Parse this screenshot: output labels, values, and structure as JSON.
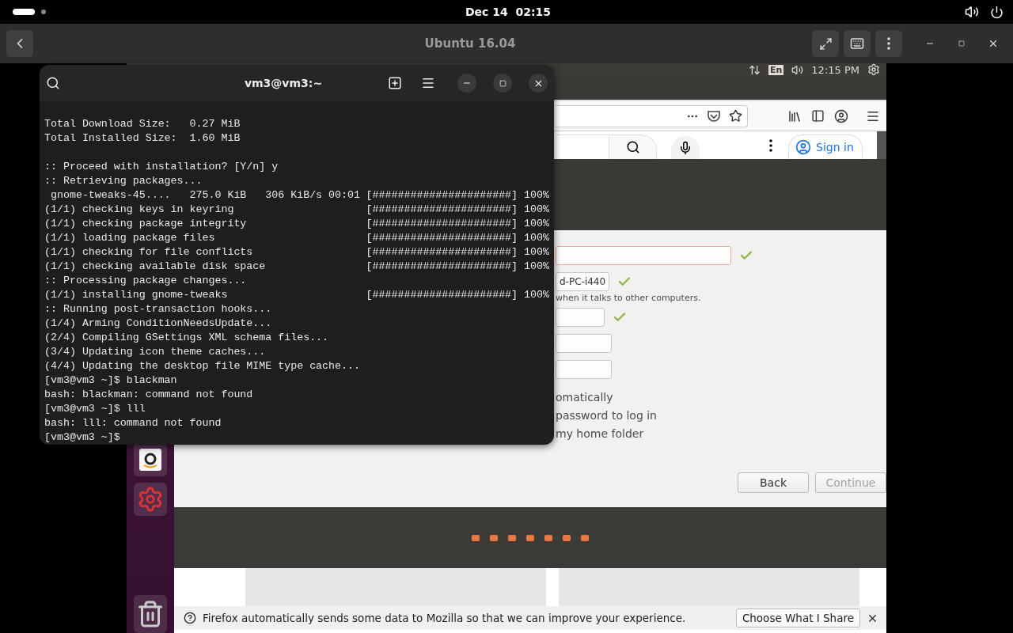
{
  "top_bar": {
    "date": "Dec 14",
    "time": "02:15"
  },
  "header": {
    "title": "Ubuntu 16.04"
  },
  "vm": {
    "panel": {
      "keyboard": "En",
      "time": "12:15 PM"
    },
    "browser": {
      "sign_in": "Sign in"
    },
    "installer": {
      "fields": [
        {
          "focused": true,
          "valid": true
        },
        {
          "value": "d-PC-i440",
          "focused": false,
          "valid": true
        },
        {
          "focused": false,
          "valid": true
        },
        {
          "focused": false,
          "valid": false
        },
        {
          "focused": false,
          "valid": false
        }
      ],
      "hint": "when it talks to other computers.",
      "options": [
        "omatically",
        "password to log in",
        "my home folder"
      ],
      "buttons": [
        {
          "label": "Back",
          "disabled": false
        },
        {
          "label": "Continue",
          "disabled": true
        }
      ]
    },
    "notification": {
      "text": "Firefox automatically sends some data to Mozilla so that we can improve your experience.",
      "button": "Choose What I Share"
    }
  },
  "terminal": {
    "title": "vm3@vm3:~",
    "lines": [
      {
        "kind": "text",
        "text": "Total Download Size:   0.27 MiB"
      },
      {
        "kind": "text",
        "text": "Total Installed Size:  1.60 MiB"
      },
      {
        "kind": "blank"
      },
      {
        "kind": "text",
        "text": ":: Proceed with installation? [Y/n] y"
      },
      {
        "kind": "text",
        "text": ":: Retrieving packages..."
      },
      {
        "kind": "progress",
        "text": " gnome-tweaks-45....   275.0 KiB   306 KiB/s 00:01",
        "bar": "[######################]",
        "percent": "100%"
      },
      {
        "kind": "progress",
        "text": "(1/1) checking keys in keyring",
        "bar": "[######################]",
        "percent": "100%"
      },
      {
        "kind": "progress",
        "text": "(1/1) checking package integrity",
        "bar": "[######################]",
        "percent": "100%"
      },
      {
        "kind": "progress",
        "text": "(1/1) loading package files",
        "bar": "[######################]",
        "percent": "100%"
      },
      {
        "kind": "progress",
        "text": "(1/1) checking for file conflicts",
        "bar": "[######################]",
        "percent": "100%"
      },
      {
        "kind": "progress",
        "text": "(1/1) checking available disk space",
        "bar": "[######################]",
        "percent": "100%"
      },
      {
        "kind": "text",
        "text": ":: Processing package changes..."
      },
      {
        "kind": "progress",
        "text": "(1/1) installing gnome-tweaks",
        "bar": "[######################]",
        "percent": "100%"
      },
      {
        "kind": "text",
        "text": ":: Running post-transaction hooks..."
      },
      {
        "kind": "text",
        "text": "(1/4) Arming ConditionNeedsUpdate..."
      },
      {
        "kind": "text",
        "text": "(2/4) Compiling GSettings XML schema files..."
      },
      {
        "kind": "text",
        "text": "(3/4) Updating icon theme caches..."
      },
      {
        "kind": "text",
        "text": "(4/4) Updating the desktop file MIME type cache..."
      },
      {
        "kind": "text",
        "text": "[vm3@vm3 ~]$ blackman"
      },
      {
        "kind": "text",
        "text": "bash: blackman: command not found"
      },
      {
        "kind": "text",
        "text": "[vm3@vm3 ~]$ lll"
      },
      {
        "kind": "text",
        "text": "bash: lll: command not found"
      },
      {
        "kind": "text",
        "text": "[vm3@vm3 ~]$"
      }
    ]
  }
}
